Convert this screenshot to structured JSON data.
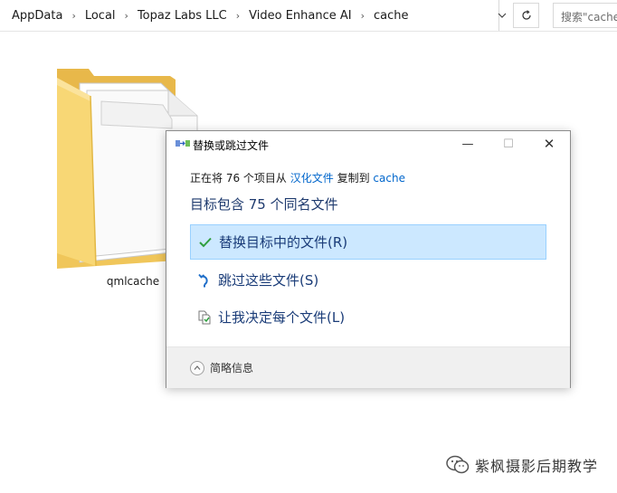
{
  "address_bar": {
    "breadcrumbs": [
      "AppData",
      "Local",
      "Topaz Labs LLC",
      "Video Enhance AI",
      "cache"
    ],
    "separator": "›",
    "search_placeholder": "搜索\"cache\""
  },
  "folder": {
    "name": "qmlcache"
  },
  "dialog": {
    "title": "替换或跳过文件",
    "copy_prefix": "正在将 76 个项目从",
    "source": "汉化文件",
    "copy_middle": "复制到",
    "destination": "cache",
    "conflict_heading": "目标包含 75 个同名文件",
    "options": [
      {
        "label": "替换目标中的文件(R)",
        "icon": "checkmark-icon",
        "selected": true
      },
      {
        "label": "跳过这些文件(S)",
        "icon": "skip-arrow-icon",
        "selected": false
      },
      {
        "label": "让我决定每个文件(L)",
        "icon": "compare-files-icon",
        "selected": false
      }
    ],
    "details_label": "简略信息",
    "controls": {
      "minimize": "—",
      "maximize": "☐",
      "close": "✕"
    }
  },
  "watermark": {
    "text": "紫枫摄影后期教学"
  },
  "colors": {
    "selected_bg": "#cce8ff",
    "selected_border": "#99d1ff",
    "link": "#0066cc",
    "option_text": "#1a3c78",
    "check_green": "#2e9e3e",
    "folder_yellow": "#f8d775"
  }
}
